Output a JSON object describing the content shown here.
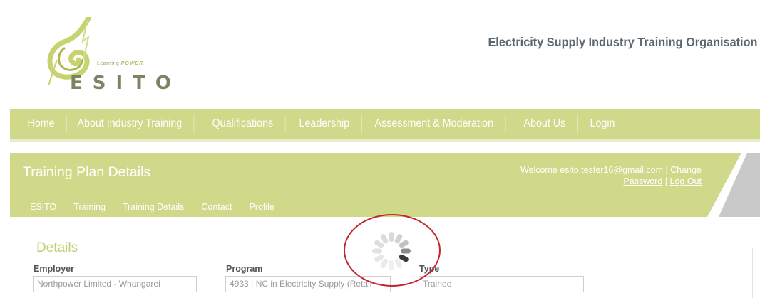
{
  "header": {
    "logo": {
      "wordmark": "ESITO",
      "tagline_prefix": "Learning",
      "tagline_emphasis": "POWER"
    },
    "org_title": "Electricity Supply Industry Training Organisation"
  },
  "nav": {
    "items": [
      {
        "label": "Home"
      },
      {
        "label": "About Industry Training"
      },
      {
        "label": "Qualifications"
      },
      {
        "label": "Leadership"
      },
      {
        "label": "Assessment & Moderation"
      },
      {
        "label": "About Us"
      },
      {
        "label": "Login"
      }
    ]
  },
  "panel": {
    "title": "Training Plan Details",
    "welcome_text": "Welcome esito.tester16@gmail.com |",
    "change_password_line1": "Change",
    "change_password_line2": "Password",
    "separator": "|",
    "logout_label": "Log Out",
    "subnav": [
      {
        "label": "ESITO"
      },
      {
        "label": "Training"
      },
      {
        "label": "Training Details"
      },
      {
        "label": "Contact"
      },
      {
        "label": "Profile"
      }
    ]
  },
  "details": {
    "legend": "Details",
    "employer": {
      "label": "Employer",
      "value": "Northpower Limited - Whangarei"
    },
    "program": {
      "label": "Program",
      "value": "4933 : NC in Electricity Supply (Retail"
    },
    "type": {
      "label": "Type",
      "value": "Trainee"
    }
  },
  "colors": {
    "nav_bg": "#cfd989",
    "accent_green": "#c2cf70",
    "highlight_red": "#c3272e",
    "corner_grey": "#c9c9c9"
  },
  "icons": {
    "logo": "esito-swirl-logo",
    "loading": "loading-spinner-icon"
  }
}
